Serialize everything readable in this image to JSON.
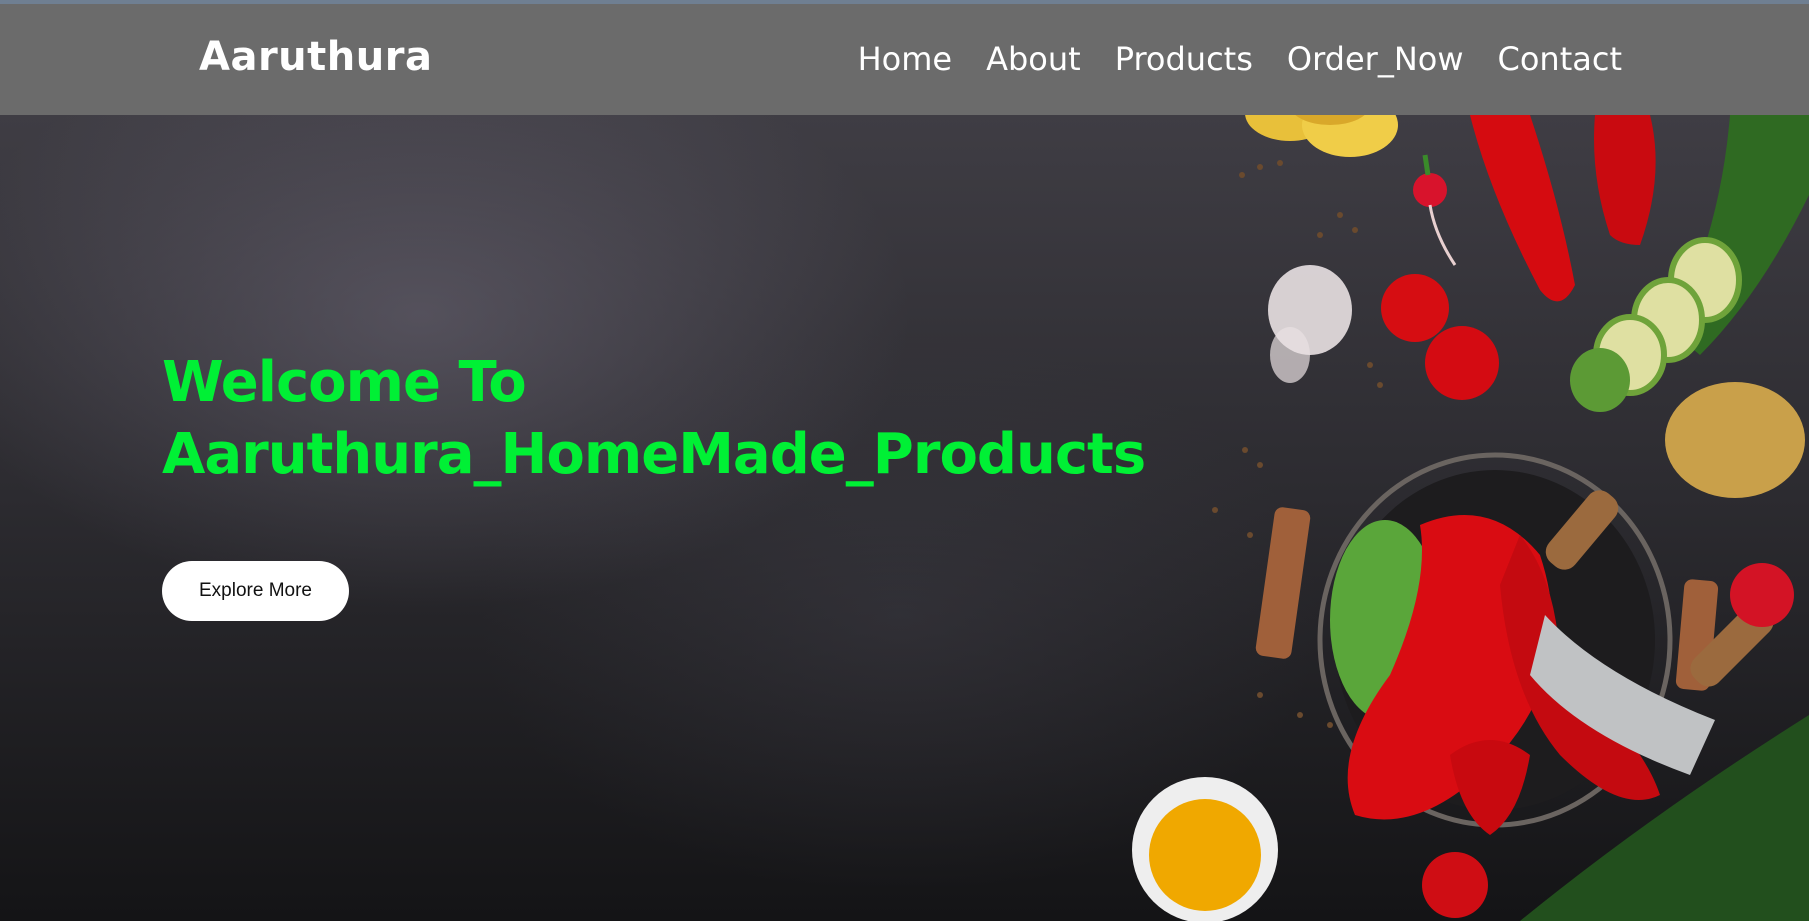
{
  "brand": "Aaruthura",
  "nav": {
    "items": [
      "Home",
      "About",
      "Products",
      "Order_Now",
      "Contact"
    ]
  },
  "hero": {
    "headline_line1": "Welcome To",
    "headline_line2": "Aaruthura_HomeMade_Products",
    "cta_label": "Explore More"
  },
  "colors": {
    "navbar_bg": "#6b6b6b",
    "headline": "#00f035",
    "cta_bg": "#ffffff"
  }
}
